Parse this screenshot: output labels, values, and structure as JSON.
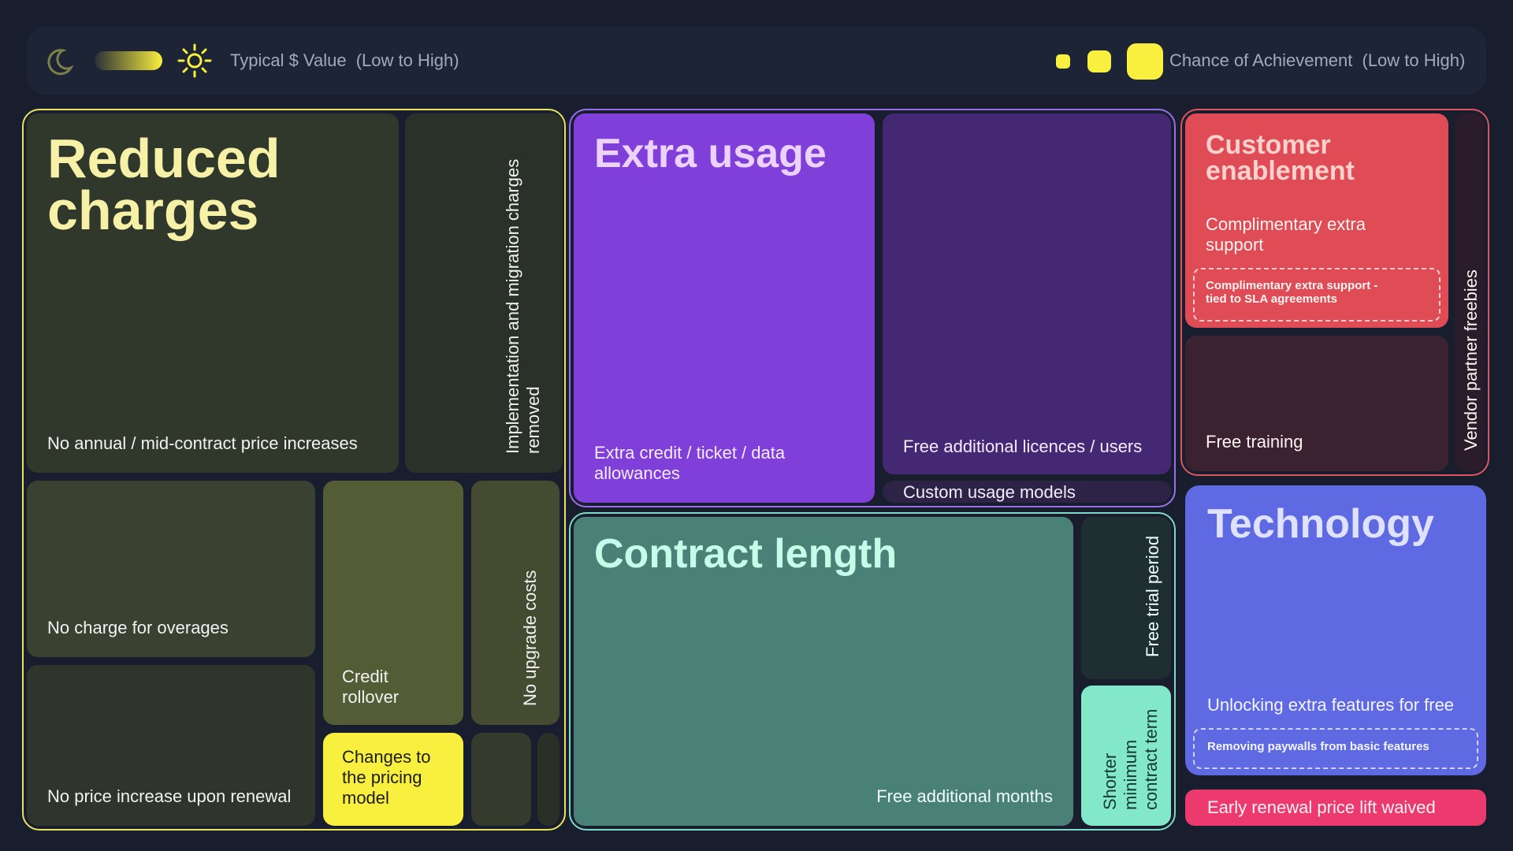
{
  "legend": {
    "value_label": "Typical $ Value",
    "value_range": "(Low to High)",
    "chance_label": "Chance of Achievement",
    "chance_range": "(Low to High)",
    "icons": [
      "moon-icon",
      "gradient-bar",
      "sun-icon"
    ],
    "accent_color": "#f9ef3e"
  },
  "groups": {
    "reduced_charges": {
      "title": "Reduced charges",
      "border_color": "#e8e35a",
      "tiles": {
        "price_increases": "No annual / mid-contract price increases",
        "implementation": "Implementation and migration charges removed",
        "overages": "No charge for overages",
        "credit_rollover": "Credit rollover",
        "upgrade_costs": "No upgrade costs",
        "renewal_price": "No price increase upon renewal",
        "pricing_model": "Changes to the pricing model"
      }
    },
    "extra_usage": {
      "title": "Extra usage",
      "border_color": "#9a6ee8",
      "tiles": {
        "allowances": "Extra credit / ticket / data allowances",
        "licences": "Free additional licences / users",
        "custom_models": "Custom usage models"
      }
    },
    "customer_enablement": {
      "title": "Customer enablement",
      "border_color": "#e0545d",
      "tiles": {
        "extra_support": "Complimentary extra support",
        "extra_support_sla": "Complimentary extra support - tied to SLA agreements",
        "free_training": "Free training",
        "vendor_freebies": "Vendor partner freebies"
      }
    },
    "contract_length": {
      "title": "Contract length",
      "border_color": "#7fd9c6",
      "tiles": {
        "free_months": "Free additional months",
        "free_trial": "Free trial period",
        "shorter_term": "Shorter minimum contract term"
      }
    },
    "technology": {
      "title": "Technology",
      "tiles": {
        "unlocking_features": "Unlocking extra features for free",
        "paywalls": "Removing paywalls from basic features",
        "early_renewal": "Early renewal price lift waived"
      }
    }
  }
}
